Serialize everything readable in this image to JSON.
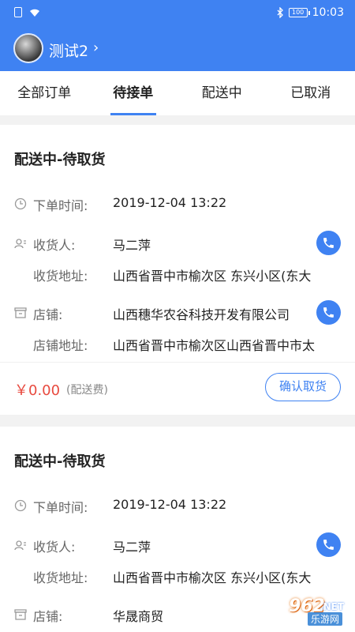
{
  "status_bar": {
    "battery": "100",
    "time": "10:03"
  },
  "header": {
    "user_name": "测试2",
    "chevron": "›"
  },
  "tabs": [
    {
      "label": "全部订单",
      "active": false
    },
    {
      "label": "待接单",
      "active": true
    },
    {
      "label": "配送中",
      "active": false
    },
    {
      "label": "已取消",
      "active": false
    }
  ],
  "orders": [
    {
      "status_title": "配送中-待取货",
      "order_time_label": "下单时间:",
      "order_time": "2019-12-04 13:22",
      "receiver_label": "收货人:",
      "receiver": "马二萍",
      "receiver_address_label": "收货地址:",
      "receiver_address": "山西省晋中市榆次区 东兴小区(东大",
      "store_label": "店铺:",
      "store": "山西穗华农谷科技开发有限公司",
      "store_address_label": "店铺地址:",
      "store_address": "山西省晋中市榆次区山西省晋中市太",
      "price": "￥0.00",
      "fee_note": "(配送费)",
      "action_label": "确认取货"
    },
    {
      "status_title": "配送中-待取货",
      "order_time_label": "下单时间:",
      "order_time": "2019-12-04 13:22",
      "receiver_label": "收货人:",
      "receiver": "马二萍",
      "receiver_address_label": "收货地址:",
      "receiver_address": "山西省晋中市榆次区 东兴小区(东大",
      "store_label": "店铺:",
      "store": "华晟商贸"
    }
  ],
  "watermark": {
    "number": "962",
    "net": ".NET",
    "text": "乐游网"
  },
  "colors": {
    "primary": "#3f82f2",
    "price": "#e84a3f"
  }
}
